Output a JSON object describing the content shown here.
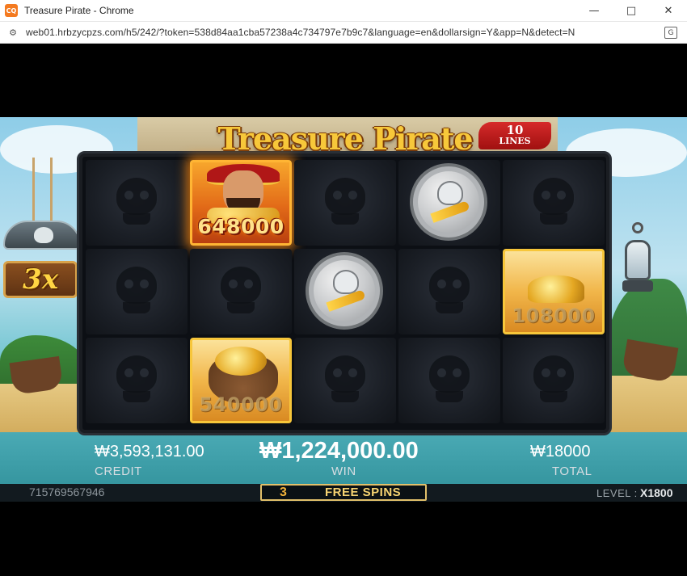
{
  "window": {
    "title": "Treasure Pirate - Chrome",
    "app_icon": "app-logo-icon",
    "url": "web01.hrbzycpzs.com/h5/242/?token=538d84aa1cba57238a4c734797e7b9c7&language=en&dollarsign=Y&app=N&detect=N",
    "controls": [
      "minimize-icon",
      "maximize-icon",
      "close-icon"
    ]
  },
  "game": {
    "logo": "Treasure Pirate",
    "lines_number": "10",
    "lines_label": "LINES",
    "multiplier": "3x",
    "reels": [
      [
        {
          "symbol": "blank"
        },
        {
          "symbol": "blank"
        },
        {
          "symbol": "blank"
        }
      ],
      [
        {
          "symbol": "captain",
          "value": "648000"
        },
        {
          "symbol": "blank"
        },
        {
          "symbol": "gold-pouch",
          "value": "540000"
        }
      ],
      [
        {
          "symbol": "blank"
        },
        {
          "symbol": "scatter-coin"
        },
        {
          "symbol": "blank"
        }
      ],
      [
        {
          "symbol": "scatter-coin"
        },
        {
          "symbol": "blank"
        },
        {
          "symbol": "blank"
        }
      ],
      [
        {
          "symbol": "blank"
        },
        {
          "symbol": "gold-pile",
          "value": "108000"
        },
        {
          "symbol": "blank"
        }
      ]
    ],
    "credit_value": "₩3,593,131.00",
    "credit_label": "CREDIT",
    "win_value": "₩1,224,000.00",
    "win_label": "WIN",
    "total_value": "₩18000",
    "total_label": "TOTAL",
    "serial": "715769567946",
    "free_spins_count": "3",
    "free_spins_label": "FREE SPINS",
    "level_label": "LEVEL :",
    "level_value": "X1800"
  }
}
